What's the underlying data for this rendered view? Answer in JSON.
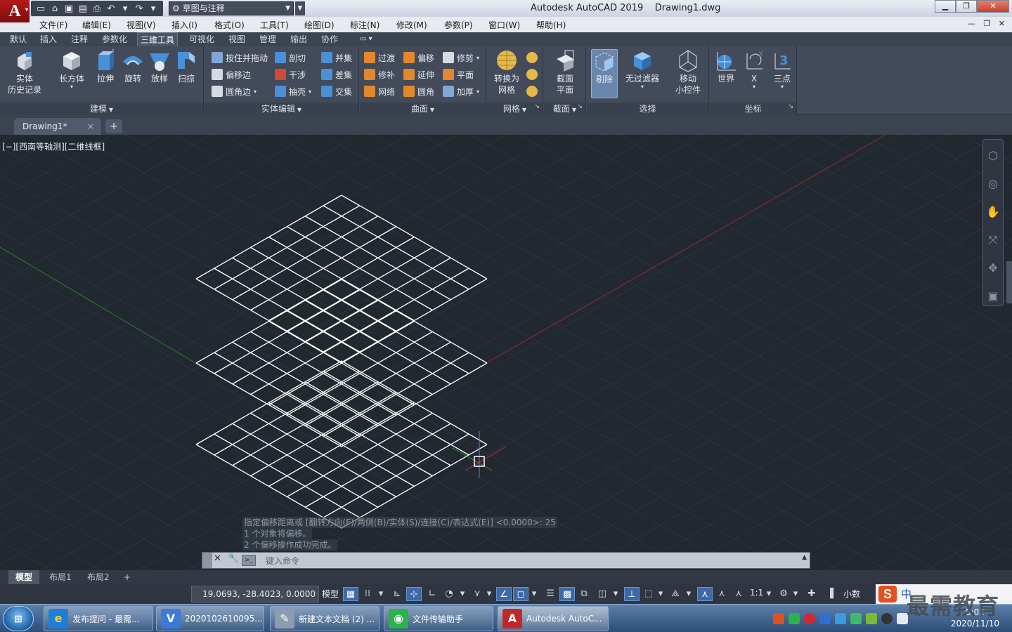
{
  "app": {
    "logo_letter": "A",
    "title": "Autodesk AutoCAD 2019    Drawing1.dwg",
    "workspace": "草图与注释",
    "window_controls": [
      "▁",
      "❐",
      "✕"
    ]
  },
  "menu": [
    "文件(F)",
    "编辑(E)",
    "视图(V)",
    "插入(I)",
    "格式(O)",
    "工具(T)",
    "绘图(D)",
    "标注(N)",
    "修改(M)",
    "参数(P)",
    "窗口(W)",
    "帮助(H)"
  ],
  "ribbon_tabs": [
    "默认",
    "插入",
    "注释",
    "参数化",
    "三维工具",
    "可视化",
    "视图",
    "管理",
    "输出",
    "协作"
  ],
  "ribbon_active_tab": "三维工具",
  "ribbon_tab_extra": "▭ ▾",
  "panels": {
    "modeling": {
      "title": "建模",
      "history": [
        "实体",
        "历史记录"
      ],
      "buttons": [
        "长方体",
        "拉伸",
        "旋转",
        "放样",
        "扫掠"
      ]
    },
    "solid_edit": {
      "title": "实体编辑",
      "items": [
        "按住并拖动",
        "偏移边",
        "圆角边",
        "剖切",
        "干涉",
        "抽壳",
        "并集",
        "差集",
        "交集"
      ]
    },
    "surface": {
      "title": "曲面",
      "items": [
        "过渡",
        "修补",
        "网络",
        "偏移",
        "延伸",
        "圆角",
        "修剪",
        "平面",
        "加厚"
      ]
    },
    "mesh": {
      "title": "网格",
      "convert": [
        "转换为",
        "网格"
      ]
    },
    "section": {
      "title": "截面",
      "plane": [
        "截面",
        "平面"
      ]
    },
    "selection": {
      "title": "选择",
      "cull": "剔除",
      "nofilter": "无过滤器",
      "gizmo": [
        "移动",
        "小控件"
      ]
    },
    "coordinates": {
      "title": "坐标",
      "world": "世界",
      "x": "X",
      "three_point": "三点"
    }
  },
  "file_tab": {
    "name": "Drawing1*",
    "close": "×",
    "new": "+"
  },
  "viewport": {
    "label": "[−][西南等轴测][二维线框]",
    "colors": {
      "background": "#212830",
      "grid": "#2c333e",
      "x_axis": "#8a2f2f",
      "y_axis": "#2f7a2f",
      "wire": "#ffffff"
    }
  },
  "command": {
    "history": [
      "指定偏移距离或 [翻转方向(F)/两侧(B)/实体(S)/连接(C)/表达式(E)] <0.0000>: 25",
      "1 个对象将偏移。",
      "2 个偏移操作成功完成。"
    ],
    "placeholder": "键入命令"
  },
  "layout_tabs": [
    "模型",
    "布局1",
    "布局2",
    "+"
  ],
  "status": {
    "coordinates": "19.0693, -28.4023, 0.0000",
    "space": "模型",
    "scale": "1:1",
    "units": "小数"
  },
  "ime": {
    "logo": "S",
    "mode": "中"
  },
  "watermark": "最需教育",
  "taskbar": {
    "start": "⊞",
    "items": [
      {
        "label": "发布提问 - 最需...",
        "icon": "e",
        "color": "#1e7fd6"
      },
      {
        "label": "2020102610095...",
        "icon": "V",
        "color": "#3b7ad8"
      },
      {
        "label": "新建文本文档 (2) ...",
        "icon": "✎",
        "color": "#8c9bb0"
      },
      {
        "label": "文件传输助手",
        "icon": "◉",
        "color": "#2bb34a"
      },
      {
        "label": "Autodesk AutoC...",
        "icon": "A",
        "color": "#c0282a"
      }
    ],
    "clock_time": "8:02",
    "clock_date": "2020/11/10"
  }
}
